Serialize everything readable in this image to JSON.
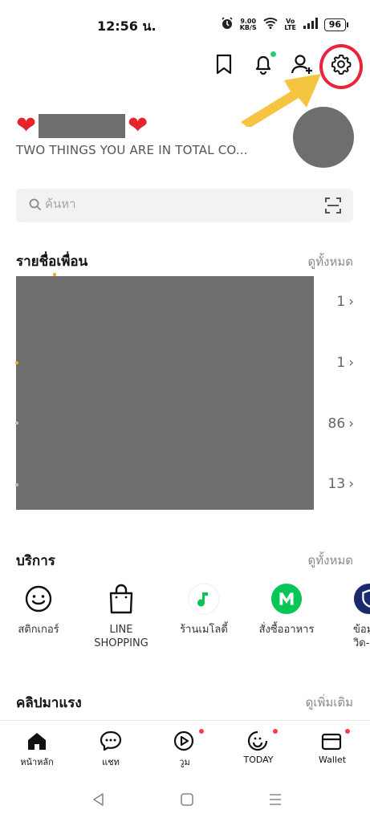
{
  "status_bar": {
    "time": "12:56 น.",
    "net_speed_value": "9.00",
    "net_speed_unit": "KB/S",
    "volte": "Vo LTE",
    "battery": "96"
  },
  "profile": {
    "status_message": "TWO THINGS YOU ARE IN TOTAL CO..."
  },
  "search": {
    "placeholder": "ค้นหา"
  },
  "friends": {
    "title": "รายชื่อเพื่อน",
    "see_all": "ดูทั้งหมด",
    "counts": [
      "1",
      "1",
      "86",
      "13"
    ]
  },
  "services": {
    "title": "บริการ",
    "see_all": "ดูทั้งหมด",
    "items": [
      {
        "label": "สติกเกอร์",
        "icon": "smiley-icon"
      },
      {
        "label": "LINE\nSHOPPING",
        "icon": "shopping-bag-icon"
      },
      {
        "label": "ร้านเมโลดี้",
        "icon": "melody-icon"
      },
      {
        "label": "สั่งซื้ออาหาร",
        "icon": "food-order-icon"
      },
      {
        "label": "ข้อมู\nวิด-",
        "icon": "covid-info-icon"
      }
    ]
  },
  "clips": {
    "title": "คลิปมาแรง",
    "see_more": "ดูเพิ่มเติม"
  },
  "bottom_nav": {
    "items": [
      {
        "label": "หน้าหลัก",
        "icon": "home-icon"
      },
      {
        "label": "แชท",
        "icon": "chat-icon"
      },
      {
        "label": "วูม",
        "icon": "voom-icon"
      },
      {
        "label": "TODAY",
        "icon": "today-icon"
      },
      {
        "label": "Wallet",
        "icon": "wallet-icon"
      }
    ]
  },
  "colors": {
    "highlight_ring": "#e8233a",
    "arrow": "#f5c542",
    "melody_green": "#06c755",
    "notif_green": "#2ecc71",
    "badge_red": "#ff3b4a"
  }
}
